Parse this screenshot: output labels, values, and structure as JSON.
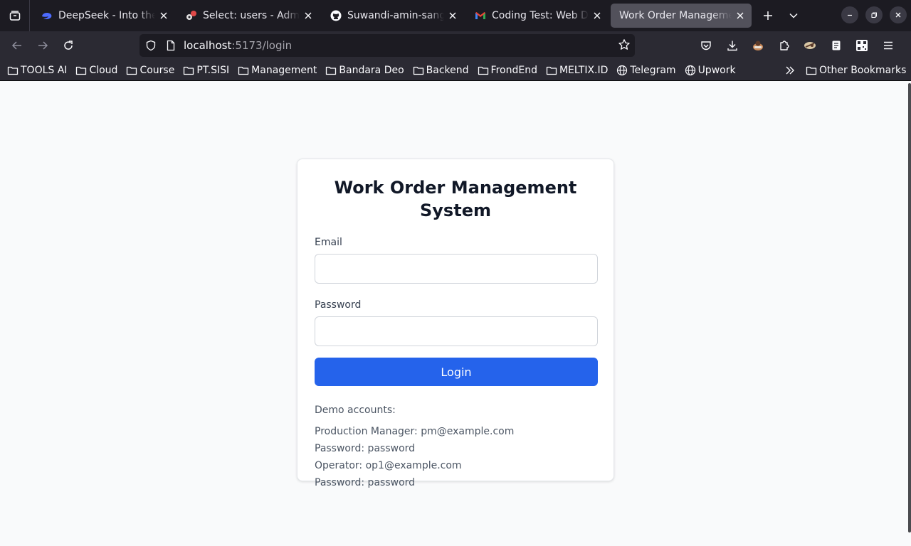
{
  "browser": {
    "tabs": [
      {
        "title": "DeepSeek - Into the Unknown",
        "icon": "deepseek-whale-icon",
        "active": false
      },
      {
        "title": "Select: users - Adminer",
        "icon": "adminer-icon",
        "active": false
      },
      {
        "title": "Suwandi-amin-sangaji/",
        "icon": "github-icon",
        "active": false
      },
      {
        "title": "Coding Test: Web Dev",
        "icon": "gmail-icon",
        "active": false
      },
      {
        "title": "Work Order Management",
        "icon": "none",
        "active": true
      }
    ],
    "url": {
      "host": "localhost",
      "rest": ":5173/login"
    },
    "bookmarks": [
      {
        "label": "TOOLS AI",
        "icon": "folder-icon"
      },
      {
        "label": "Cloud",
        "icon": "folder-icon"
      },
      {
        "label": "Course",
        "icon": "folder-icon"
      },
      {
        "label": "PT.SISI",
        "icon": "folder-icon"
      },
      {
        "label": "Management",
        "icon": "folder-icon"
      },
      {
        "label": "Bandara Deo",
        "icon": "folder-icon"
      },
      {
        "label": "Backend",
        "icon": "folder-icon"
      },
      {
        "label": "FrondEnd",
        "icon": "folder-icon"
      },
      {
        "label": "MELTIX.ID",
        "icon": "folder-icon"
      },
      {
        "label": "Telegram",
        "icon": "globe-icon"
      },
      {
        "label": "Upwork",
        "icon": "globe-icon"
      }
    ],
    "other_bookmarks": "Other Bookmarks"
  },
  "login": {
    "title": "Work Order Management System",
    "email_label": "Email",
    "email_value": "",
    "password_label": "Password",
    "password_value": "",
    "button_label": "Login",
    "demo_title": "Demo accounts:",
    "demo_lines": [
      "Production Manager: pm@example.com",
      "Password: password",
      "Operator: op1@example.com",
      "Password: password"
    ]
  },
  "colors": {
    "primary": "#2563eb",
    "page_bg": "#f9fafb",
    "browser_dark": "#1c1b22",
    "toolbar": "#2b2a33"
  }
}
